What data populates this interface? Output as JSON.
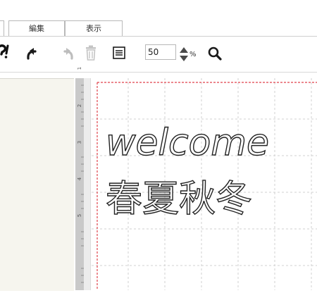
{
  "menu": {
    "tabs": [
      {
        "label": "編集"
      },
      {
        "label": "表示"
      }
    ]
  },
  "toolbar": {
    "zoom_value": "50",
    "zoom_unit": "%",
    "icons": [
      "help-icon",
      "undo-icon",
      "redo-icon",
      "trash-icon",
      "list-icon",
      "zoom-stepper-icon",
      "search-icon"
    ]
  },
  "ruler": {
    "labels": [
      "1",
      "2",
      "3",
      "4",
      "5"
    ]
  },
  "canvas": {
    "lines": [
      "welcome",
      "春夏秋冬"
    ],
    "guide_color": "#e0424b",
    "grid_color": "#c8c8c8"
  }
}
